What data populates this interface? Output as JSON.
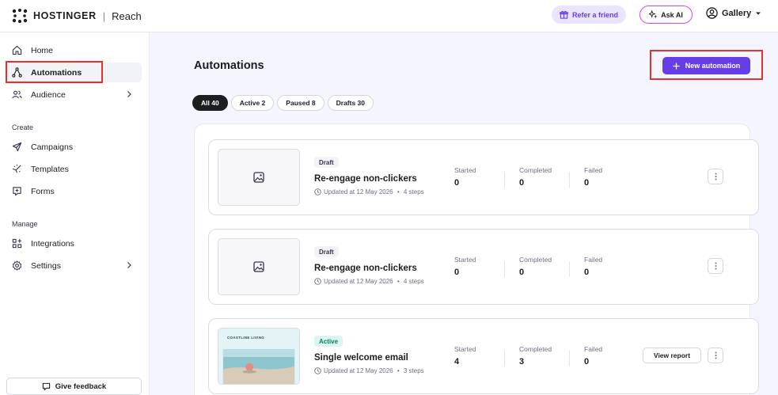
{
  "header": {
    "brand": "HOSTINGER",
    "separator": "|",
    "product": "Reach",
    "refer_label": "Refer a friend",
    "ask_ai_label": "Ask AI",
    "account_label": "Gallery"
  },
  "sidebar": {
    "items_top": [
      {
        "label": "Home",
        "icon": "home-icon"
      },
      {
        "label": "Automations",
        "icon": "automations-icon",
        "active": true
      },
      {
        "label": "Audience",
        "icon": "audience-icon",
        "chevron": true
      }
    ],
    "create_label": "Create",
    "items_create": [
      {
        "label": "Campaigns",
        "icon": "send-icon"
      },
      {
        "label": "Templates",
        "icon": "templates-icon"
      },
      {
        "label": "Forms",
        "icon": "forms-icon"
      }
    ],
    "manage_label": "Manage",
    "items_manage": [
      {
        "label": "Integrations",
        "icon": "integrations-icon"
      },
      {
        "label": "Settings",
        "icon": "settings-icon",
        "chevron": true
      }
    ],
    "feedback_label": "Give feedback"
  },
  "main": {
    "title": "Automations",
    "new_button_label": "New automation",
    "filters": [
      {
        "label": "All 40",
        "active": true
      },
      {
        "label": "Active 2"
      },
      {
        "label": "Paused 8"
      },
      {
        "label": "Drafts 30"
      }
    ],
    "cards": [
      {
        "status": "Draft",
        "title": "Re-engage non-clickers",
        "updated": "Updated at 12 May 2026",
        "steps": "4 steps",
        "started_label": "Started",
        "started": "0",
        "completed_label": "Completed",
        "completed": "0",
        "failed_label": "Failed",
        "failed": "0"
      },
      {
        "status": "Draft",
        "title": "Re-engage non-clickers",
        "updated": "Updated at 12 May 2026",
        "steps": "4 steps",
        "started_label": "Started",
        "started": "0",
        "completed_label": "Completed",
        "completed": "0",
        "failed_label": "Failed",
        "failed": "0"
      },
      {
        "status": "Active",
        "title": "Single welcome email",
        "updated": "Updated at 12 May 2026",
        "steps": "3 steps",
        "started_label": "Started",
        "started": "4",
        "completed_label": "Completed",
        "completed": "3",
        "failed_label": "Failed",
        "failed": "0",
        "report_label": "View report",
        "thumb_caption": "COASTLINE LIVING"
      }
    ]
  },
  "colors": {
    "accent": "#673de6",
    "highlight": "#e8312a",
    "active_badge": "#008361",
    "background": "#f4f5ff"
  }
}
